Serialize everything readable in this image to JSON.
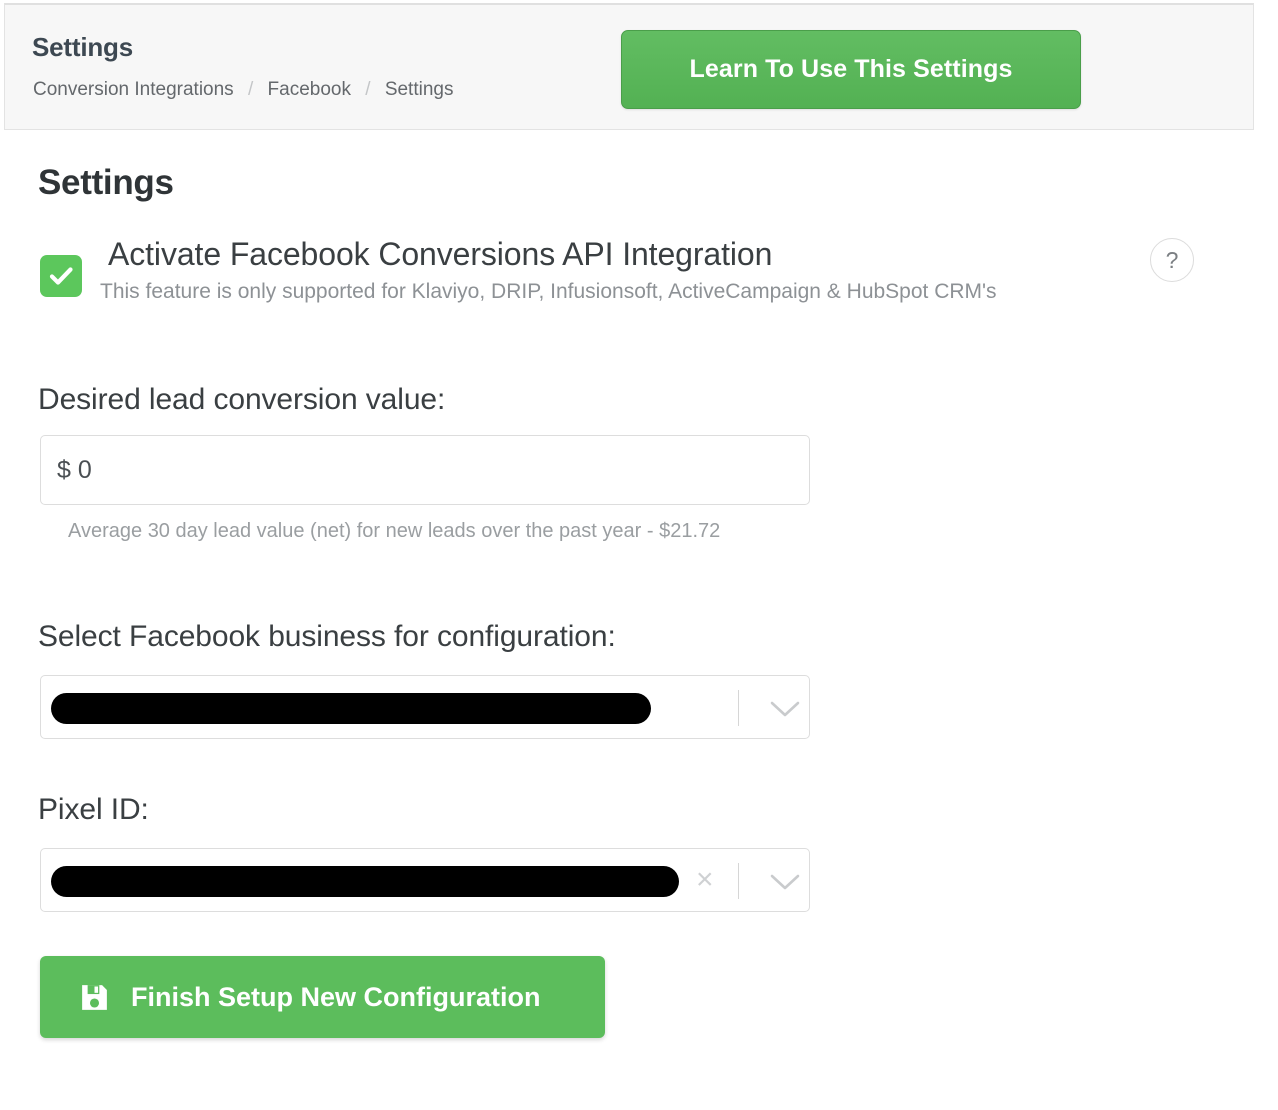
{
  "header": {
    "title": "Settings",
    "breadcrumb": [
      {
        "label": "Conversion Integrations"
      },
      {
        "label": "Facebook"
      },
      {
        "label": "Settings"
      }
    ],
    "breadcrumb_separator": "/",
    "learn_button_label": "Learn To Use This Settings"
  },
  "main": {
    "section_heading": "Settings",
    "activate": {
      "checked": true,
      "check_icon": "check-icon",
      "label": "Activate Facebook Conversions API Integration",
      "description": "This feature is only supported for Klaviyo, DRIP, Infusionsoft, ActiveCampaign & HubSpot CRM's",
      "help_icon_label": "?"
    },
    "lead_value": {
      "label": "Desired lead conversion value:",
      "value": "$ 0",
      "placeholder": "$ 0",
      "hint": "Average 30 day lead value (net) for new leads over the past year - $21.72"
    },
    "business_select": {
      "label": "Select Facebook business for configuration:",
      "value": "",
      "value_redacted": true,
      "chevron_icon": "chevron-down-icon"
    },
    "pixel_select": {
      "label": "Pixel ID:",
      "value": "",
      "value_redacted": true,
      "clear_icon": "close-icon",
      "clear_label": "×",
      "chevron_icon": "chevron-down-icon"
    },
    "finish_button": {
      "label": "Finish Setup New Configuration",
      "icon": "save-icon"
    }
  },
  "colors": {
    "accent_green": "#5cb85c",
    "button_green": "#5cbd5c",
    "checkbox_green": "#5cc75c",
    "header_bg": "#f7f7f7",
    "text_dark": "#3a3f42",
    "text_muted": "#8d9195"
  }
}
